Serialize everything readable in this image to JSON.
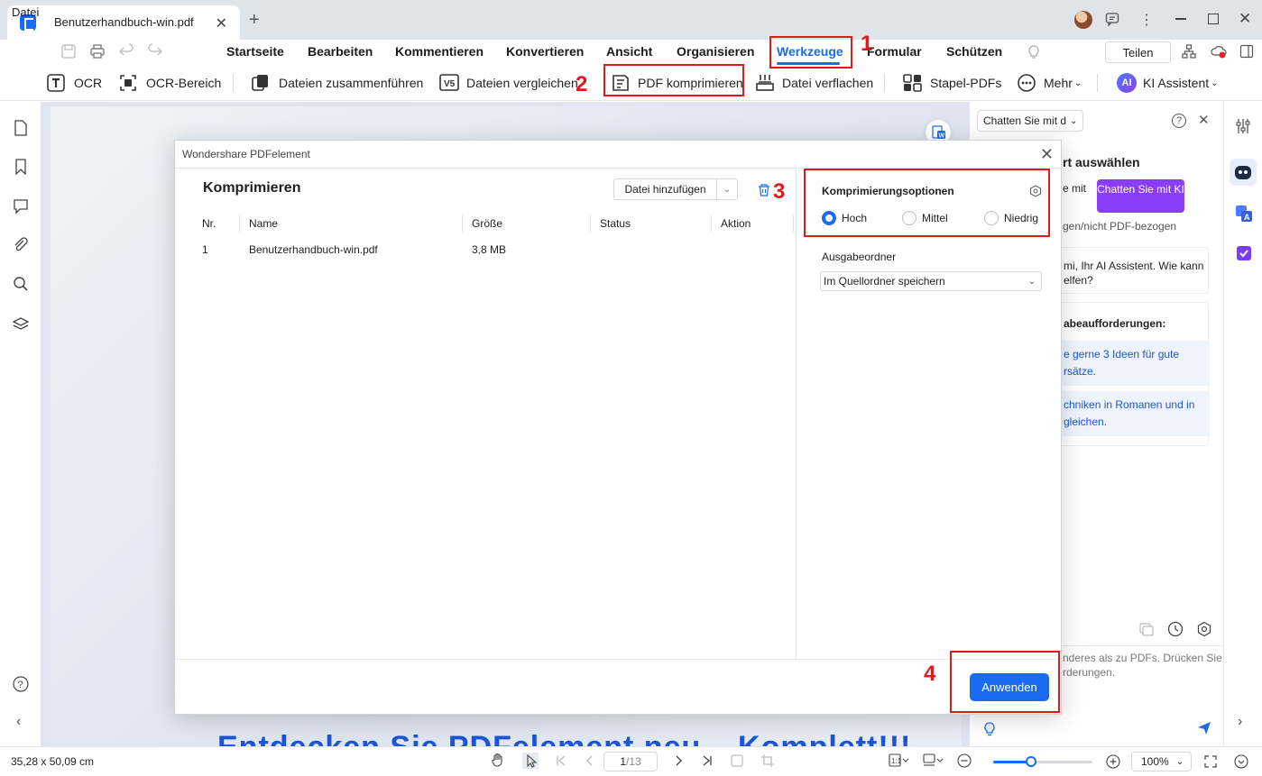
{
  "tab": {
    "title": "Benutzerhandbuch-win.pdf"
  },
  "menu": {
    "file": "Datei",
    "items": [
      "Startseite",
      "Bearbeiten",
      "Kommentieren",
      "Konvertieren",
      "Ansicht",
      "Organisieren",
      "Werkzeuge",
      "Formular",
      "Schützen"
    ],
    "active": "Werkzeuge",
    "share": "Teilen"
  },
  "toolbar": {
    "ocr": "OCR",
    "ocr_area": "OCR-Bereich",
    "merge": "Dateien zusammenführen",
    "compare": "Dateien vergleichen",
    "compress": "PDF komprimieren",
    "flatten": "Datei verflachen",
    "batch": "Stapel-PDFs",
    "more": "Mehr",
    "ai": "KI Assistent",
    "ai_badge": "AI"
  },
  "dialog": {
    "title": "Wondershare PDFelement",
    "heading": "Komprimieren",
    "add_file": "Datei hinzufügen",
    "columns": {
      "nr": "Nr.",
      "name": "Name",
      "size": "Größe",
      "status": "Status",
      "action": "Aktion"
    },
    "rows": [
      {
        "nr": "1",
        "name": "Benutzerhandbuch-win.pdf",
        "size": "3,8 MB",
        "status": "",
        "action": ""
      }
    ],
    "options_title": "Komprimierungsoptionen",
    "levels": [
      "Hoch",
      "Mittel",
      "Niedrig"
    ],
    "selected_level": "Hoch",
    "output_label": "Ausgabeordner",
    "output_value": "Im Quellordner speichern",
    "apply": "Anwenden"
  },
  "ai_panel": {
    "dropdown": "Chatten Sie mit d",
    "section_title": "rt auswählen",
    "chat_left": "e mit",
    "chat_button": "Chatten Sie mit KI",
    "related": "gen/nicht PDF-bezogen",
    "greeting": "mi, Ihr AI Assistent. Wie kann\nelfen?",
    "prompts_title": "abeaufforderungen:",
    "prompt1": "e gerne 3 Ideen für gute\nrsätze.",
    "prompt2": "chniken in Romanen und in\ngleichen.",
    "input_hint": "nderes als zu PDFs. Drücken Sie\nrderungen."
  },
  "document": {
    "heading": "Entdecken Sie PDFelement neu – Komplett!!!"
  },
  "status": {
    "page_size": "35,28 x 50,09 cm",
    "page_current": "1",
    "page_total": "/13",
    "zoom": "100%"
  },
  "annotations": [
    "1",
    "2",
    "3",
    "4"
  ],
  "colors": {
    "accent": "#1a6bf2",
    "annotation": "#e01a1a",
    "ai_purple": "#8b3cf7"
  }
}
